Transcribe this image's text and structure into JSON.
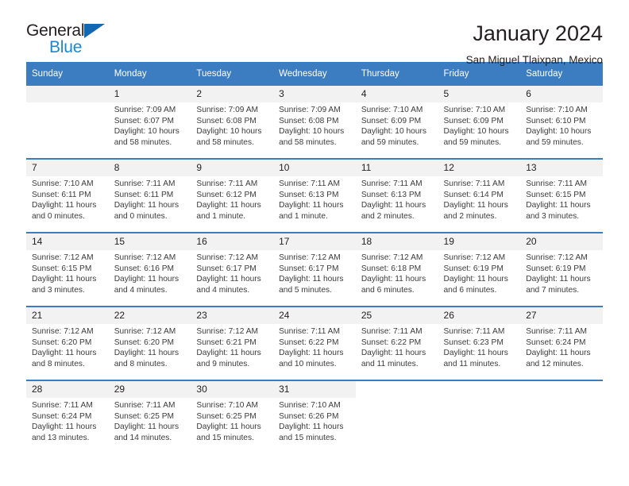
{
  "brand": {
    "name_top": "General",
    "name_bottom": "Blue",
    "triangle_color": "#1068b3",
    "blue_color": "#1b87d4"
  },
  "header": {
    "title": "January 2024",
    "subtitle": "San Miguel Tlaixpan, Mexico"
  },
  "colors": {
    "header_bar": "#3c7cc0",
    "daynum_band": "#f2f2f2",
    "text": "#231f20",
    "info_text": "#3b3b3b"
  },
  "weekday_headers": [
    "Sunday",
    "Monday",
    "Tuesday",
    "Wednesday",
    "Thursday",
    "Friday",
    "Saturday"
  ],
  "weeks": [
    [
      {
        "day": "",
        "blank": true,
        "sunrise": "",
        "sunset": "",
        "daylight1": "",
        "daylight2": ""
      },
      {
        "day": "1",
        "sunrise": "Sunrise: 7:09 AM",
        "sunset": "Sunset: 6:07 PM",
        "daylight1": "Daylight: 10 hours",
        "daylight2": "and 58 minutes."
      },
      {
        "day": "2",
        "sunrise": "Sunrise: 7:09 AM",
        "sunset": "Sunset: 6:08 PM",
        "daylight1": "Daylight: 10 hours",
        "daylight2": "and 58 minutes."
      },
      {
        "day": "3",
        "sunrise": "Sunrise: 7:09 AM",
        "sunset": "Sunset: 6:08 PM",
        "daylight1": "Daylight: 10 hours",
        "daylight2": "and 58 minutes."
      },
      {
        "day": "4",
        "sunrise": "Sunrise: 7:10 AM",
        "sunset": "Sunset: 6:09 PM",
        "daylight1": "Daylight: 10 hours",
        "daylight2": "and 59 minutes."
      },
      {
        "day": "5",
        "sunrise": "Sunrise: 7:10 AM",
        "sunset": "Sunset: 6:09 PM",
        "daylight1": "Daylight: 10 hours",
        "daylight2": "and 59 minutes."
      },
      {
        "day": "6",
        "sunrise": "Sunrise: 7:10 AM",
        "sunset": "Sunset: 6:10 PM",
        "daylight1": "Daylight: 10 hours",
        "daylight2": "and 59 minutes."
      }
    ],
    [
      {
        "day": "7",
        "sunrise": "Sunrise: 7:10 AM",
        "sunset": "Sunset: 6:11 PM",
        "daylight1": "Daylight: 11 hours",
        "daylight2": "and 0 minutes."
      },
      {
        "day": "8",
        "sunrise": "Sunrise: 7:11 AM",
        "sunset": "Sunset: 6:11 PM",
        "daylight1": "Daylight: 11 hours",
        "daylight2": "and 0 minutes."
      },
      {
        "day": "9",
        "sunrise": "Sunrise: 7:11 AM",
        "sunset": "Sunset: 6:12 PM",
        "daylight1": "Daylight: 11 hours",
        "daylight2": "and 1 minute."
      },
      {
        "day": "10",
        "sunrise": "Sunrise: 7:11 AM",
        "sunset": "Sunset: 6:13 PM",
        "daylight1": "Daylight: 11 hours",
        "daylight2": "and 1 minute."
      },
      {
        "day": "11",
        "sunrise": "Sunrise: 7:11 AM",
        "sunset": "Sunset: 6:13 PM",
        "daylight1": "Daylight: 11 hours",
        "daylight2": "and 2 minutes."
      },
      {
        "day": "12",
        "sunrise": "Sunrise: 7:11 AM",
        "sunset": "Sunset: 6:14 PM",
        "daylight1": "Daylight: 11 hours",
        "daylight2": "and 2 minutes."
      },
      {
        "day": "13",
        "sunrise": "Sunrise: 7:11 AM",
        "sunset": "Sunset: 6:15 PM",
        "daylight1": "Daylight: 11 hours",
        "daylight2": "and 3 minutes."
      }
    ],
    [
      {
        "day": "14",
        "sunrise": "Sunrise: 7:12 AM",
        "sunset": "Sunset: 6:15 PM",
        "daylight1": "Daylight: 11 hours",
        "daylight2": "and 3 minutes."
      },
      {
        "day": "15",
        "sunrise": "Sunrise: 7:12 AM",
        "sunset": "Sunset: 6:16 PM",
        "daylight1": "Daylight: 11 hours",
        "daylight2": "and 4 minutes."
      },
      {
        "day": "16",
        "sunrise": "Sunrise: 7:12 AM",
        "sunset": "Sunset: 6:17 PM",
        "daylight1": "Daylight: 11 hours",
        "daylight2": "and 4 minutes."
      },
      {
        "day": "17",
        "sunrise": "Sunrise: 7:12 AM",
        "sunset": "Sunset: 6:17 PM",
        "daylight1": "Daylight: 11 hours",
        "daylight2": "and 5 minutes."
      },
      {
        "day": "18",
        "sunrise": "Sunrise: 7:12 AM",
        "sunset": "Sunset: 6:18 PM",
        "daylight1": "Daylight: 11 hours",
        "daylight2": "and 6 minutes."
      },
      {
        "day": "19",
        "sunrise": "Sunrise: 7:12 AM",
        "sunset": "Sunset: 6:19 PM",
        "daylight1": "Daylight: 11 hours",
        "daylight2": "and 6 minutes."
      },
      {
        "day": "20",
        "sunrise": "Sunrise: 7:12 AM",
        "sunset": "Sunset: 6:19 PM",
        "daylight1": "Daylight: 11 hours",
        "daylight2": "and 7 minutes."
      }
    ],
    [
      {
        "day": "21",
        "sunrise": "Sunrise: 7:12 AM",
        "sunset": "Sunset: 6:20 PM",
        "daylight1": "Daylight: 11 hours",
        "daylight2": "and 8 minutes."
      },
      {
        "day": "22",
        "sunrise": "Sunrise: 7:12 AM",
        "sunset": "Sunset: 6:20 PM",
        "daylight1": "Daylight: 11 hours",
        "daylight2": "and 8 minutes."
      },
      {
        "day": "23",
        "sunrise": "Sunrise: 7:12 AM",
        "sunset": "Sunset: 6:21 PM",
        "daylight1": "Daylight: 11 hours",
        "daylight2": "and 9 minutes."
      },
      {
        "day": "24",
        "sunrise": "Sunrise: 7:11 AM",
        "sunset": "Sunset: 6:22 PM",
        "daylight1": "Daylight: 11 hours",
        "daylight2": "and 10 minutes."
      },
      {
        "day": "25",
        "sunrise": "Sunrise: 7:11 AM",
        "sunset": "Sunset: 6:22 PM",
        "daylight1": "Daylight: 11 hours",
        "daylight2": "and 11 minutes."
      },
      {
        "day": "26",
        "sunrise": "Sunrise: 7:11 AM",
        "sunset": "Sunset: 6:23 PM",
        "daylight1": "Daylight: 11 hours",
        "daylight2": "and 11 minutes."
      },
      {
        "day": "27",
        "sunrise": "Sunrise: 7:11 AM",
        "sunset": "Sunset: 6:24 PM",
        "daylight1": "Daylight: 11 hours",
        "daylight2": "and 12 minutes."
      }
    ],
    [
      {
        "day": "28",
        "sunrise": "Sunrise: 7:11 AM",
        "sunset": "Sunset: 6:24 PM",
        "daylight1": "Daylight: 11 hours",
        "daylight2": "and 13 minutes."
      },
      {
        "day": "29",
        "sunrise": "Sunrise: 7:11 AM",
        "sunset": "Sunset: 6:25 PM",
        "daylight1": "Daylight: 11 hours",
        "daylight2": "and 14 minutes."
      },
      {
        "day": "30",
        "sunrise": "Sunrise: 7:10 AM",
        "sunset": "Sunset: 6:25 PM",
        "daylight1": "Daylight: 11 hours",
        "daylight2": "and 15 minutes."
      },
      {
        "day": "31",
        "sunrise": "Sunrise: 7:10 AM",
        "sunset": "Sunset: 6:26 PM",
        "daylight1": "Daylight: 11 hours",
        "daylight2": "and 15 minutes."
      },
      {
        "day": "",
        "off": true,
        "sunrise": "",
        "sunset": "",
        "daylight1": "",
        "daylight2": ""
      },
      {
        "day": "",
        "off": true,
        "sunrise": "",
        "sunset": "",
        "daylight1": "",
        "daylight2": ""
      },
      {
        "day": "",
        "off": true,
        "sunrise": "",
        "sunset": "",
        "daylight1": "",
        "daylight2": ""
      }
    ]
  ]
}
